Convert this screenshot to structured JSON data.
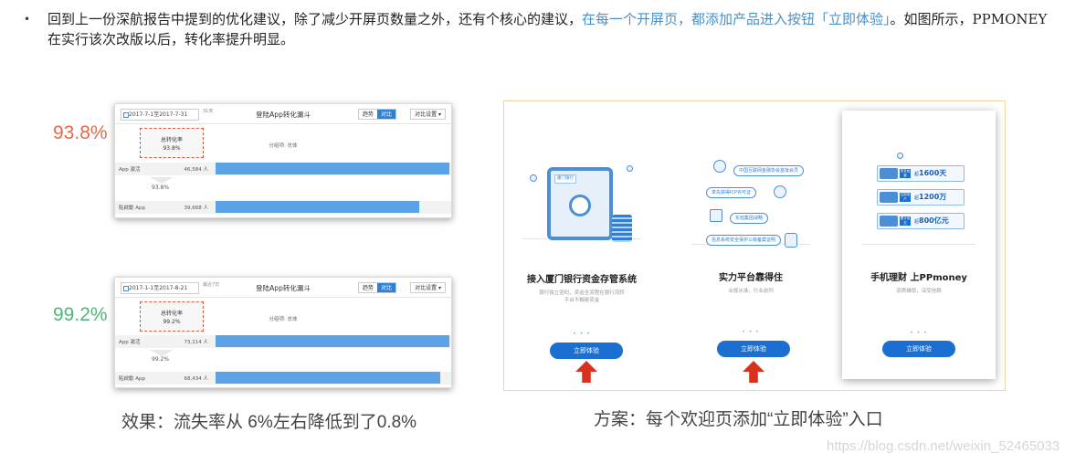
{
  "paragraph": {
    "bullet": "•",
    "before": "回到上一份深航报告中提到的优化建议，除了减少开屏页数量之外，还有个核心的建议，",
    "highlight": "在每一个开屏页，都添加产品进入按钮「立即体验」",
    "after": "。如图所示，PPMONEY在实行该次改版以后，转化率提升明显。"
  },
  "funnel_before": {
    "percent": "93.8%",
    "date_range": "2017-7-1至2017-7-31",
    "days": "31天",
    "title": "登陆App转化漏斗",
    "tab_trend": "趋势",
    "tab_compare": "对比",
    "settings": "对比设置 ▾",
    "dimension": "分组项: 总体",
    "rate_label": "总转化率",
    "rate_value": "93.8%",
    "step1_label": "App 激活",
    "step1_value": "46,584 人",
    "step_rate": "93.8%",
    "step2_label": "貼啟動 App",
    "step2_value": "39,668 人",
    "step1_fill": 1.0,
    "step2_fill": 0.938
  },
  "funnel_after": {
    "percent": "99.2%",
    "date_range": "2017-1-1至2017-8-21",
    "days": "最近7日",
    "title": "登陆App转化漏斗",
    "tab_trend": "趋势",
    "tab_compare": "对比",
    "settings": "对比设置 ▾",
    "dimension": "分组项: 总体",
    "rate_label": "总转化率",
    "rate_value": "99.2%",
    "step1_label": "App 激活",
    "step1_value": "73,114 人",
    "step_rate": "99.2%",
    "step2_label": "貼啟動 App",
    "step2_value": "68,434 人",
    "step1_fill": 1.0,
    "step2_fill": 0.992
  },
  "caption_left": "效果：流失率从 6%左右降低到了0.8%",
  "caption_right": "方案：每个欢迎页添加“立即体验”入口",
  "screens": [
    {
      "title": "接入厦门银行资金存管系统",
      "sub1": "银行独立密码，资金全流程在银行流转",
      "sub2": "平台不触碰资金",
      "safe_label": "厦门银行",
      "dots": "• • •",
      "cta": "立即体验"
    },
    {
      "title": "实力平台靠得住",
      "sub1": "合规水准，行业前列",
      "badge1": "中国互联网金融协会首批会员",
      "badge2": "率先获得ICP许可证",
      "badge3": "东旭集团战略",
      "badge4": "信息系统安全保护三级备案证明",
      "dots": "• • •",
      "cta": "立即体验"
    },
    {
      "title": "手机理财 上PPmoney",
      "sub1": "资质雄厚，深受信赖",
      "stat1_tag": "安全运营",
      "stat1_prefix": "超",
      "stat1_value": "1600天",
      "stat2_tag": "注册用户",
      "stat2_prefix": "超",
      "stat2_value": "1200万",
      "stat3_tag": "累计成交",
      "stat3_prefix": "超",
      "stat3_value": "800亿元",
      "dots": "• • •",
      "cta": "立即体验"
    }
  ],
  "watermark": "https://blog.csdn.net/weixin_52465033",
  "colors": {
    "highlight": "#4a90c8",
    "bar": "#5ba3e6",
    "cta": "#1a6fd0",
    "arrow": "#d8321f",
    "percent_before": "#e8694a",
    "percent_after": "#4cb872"
  }
}
